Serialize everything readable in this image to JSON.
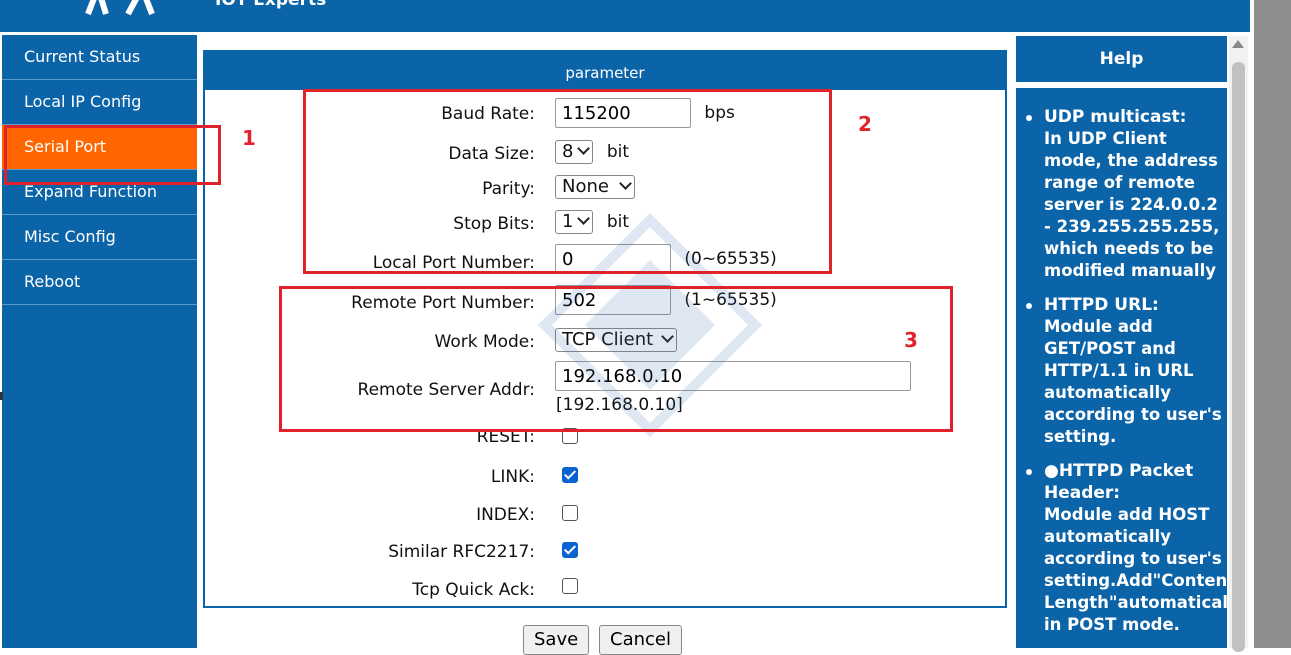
{
  "header": {
    "title": "IOT Experts"
  },
  "sidebar": {
    "items": [
      {
        "label": "Current Status"
      },
      {
        "label": "Local IP Config"
      },
      {
        "label": "Serial Port"
      },
      {
        "label": "Expand Function"
      },
      {
        "label": "Misc Config"
      },
      {
        "label": "Reboot"
      }
    ],
    "active": "Serial Port"
  },
  "panel": {
    "title": "parameter",
    "baud_rate": {
      "label": "Baud Rate:",
      "value": "115200",
      "unit": "bps"
    },
    "data_size": {
      "label": "Data Size:",
      "value": "8",
      "unit": "bit"
    },
    "parity": {
      "label": "Parity:",
      "value": "None"
    },
    "stop_bits": {
      "label": "Stop Bits:",
      "value": "1",
      "unit": "bit"
    },
    "local_port": {
      "label": "Local Port Number:",
      "value": "0",
      "range": "(0~65535)"
    },
    "remote_port": {
      "label": "Remote Port Number:",
      "value": "502",
      "range": "(1~65535)"
    },
    "work_mode": {
      "label": "Work Mode:",
      "value": "TCP Client"
    },
    "remote_addr": {
      "label": "Remote Server Addr:",
      "value": "192.168.0.10",
      "resolved": "[192.168.0.10]"
    },
    "reset": {
      "label": "RESET:",
      "checked": false
    },
    "link": {
      "label": "LINK:",
      "checked": true
    },
    "index": {
      "label": "INDEX:",
      "checked": false
    },
    "rfc2217": {
      "label": "Similar RFC2217:",
      "checked": true
    },
    "quick_ack": {
      "label": "Tcp Quick Ack:",
      "checked": false
    }
  },
  "buttons": {
    "save": "Save",
    "cancel": "Cancel"
  },
  "help": {
    "title": "Help",
    "items": [
      {
        "head": "UDP multicast:",
        "text": "In UDP Client mode, the address range of remote server is 224.0.0.2 - 239.255.255.255, which needs to be modified manually"
      },
      {
        "head": "HTTPD URL:",
        "text": "Module add GET/POST and HTTP/1.1 in URL automatically according to user's setting."
      },
      {
        "head": "●HTTPD Packet Header:",
        "text": "Module add HOST automatically according to user's setting.Add\"Content Length\"automatically in POST mode."
      }
    ]
  },
  "annotations": {
    "one": "1",
    "two": "2",
    "three": "3",
    "color": "#e0232b"
  },
  "colors": {
    "brand_blue": "#0b63a8",
    "active_orange": "#ff6600"
  }
}
